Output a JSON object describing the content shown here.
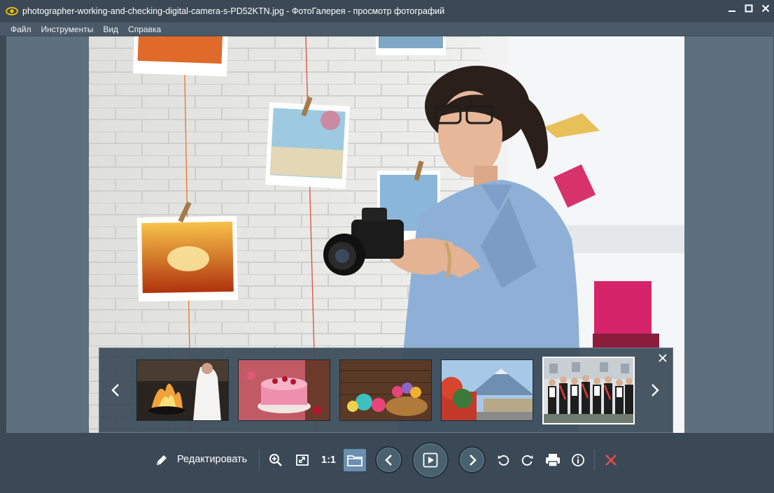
{
  "window": {
    "title": "photographer-working-and-checking-digital-camera-s-PD52KTN.jpg - ФотоГалерея - просмотр фотографий",
    "app_icon": "eye-icon",
    "controls": [
      "minimize-icon",
      "maximize-icon",
      "close-icon"
    ]
  },
  "menu": {
    "items": [
      "Файл",
      "Инструменты",
      "Вид",
      "Справка"
    ]
  },
  "viewer": {
    "image_subject": "photographer-working-and-checking-digital-camera"
  },
  "filmstrip": {
    "prev_icon": "chevron-left-icon",
    "next_icon": "chevron-right-icon",
    "close_icon": "close-icon",
    "thumbnails": [
      "chef-fire-cooking",
      "pink-cake",
      "knitted-toys-basket",
      "mountain-village",
      "graduates-group"
    ],
    "selected_index": 4
  },
  "toolbar": {
    "edit_label": "Редактировать",
    "one_to_one_label": "1:1",
    "icons": [
      "pencil-icon",
      "zoom-in-icon",
      "fit-screen-icon",
      "folder-icon",
      "previous-icon",
      "play-icon",
      "next-icon",
      "rotate-left-icon",
      "rotate-right-icon",
      "print-icon",
      "info-icon",
      "delete-icon"
    ],
    "accent_color": "#6a8fb0",
    "delete_color": "#e84b4b"
  }
}
